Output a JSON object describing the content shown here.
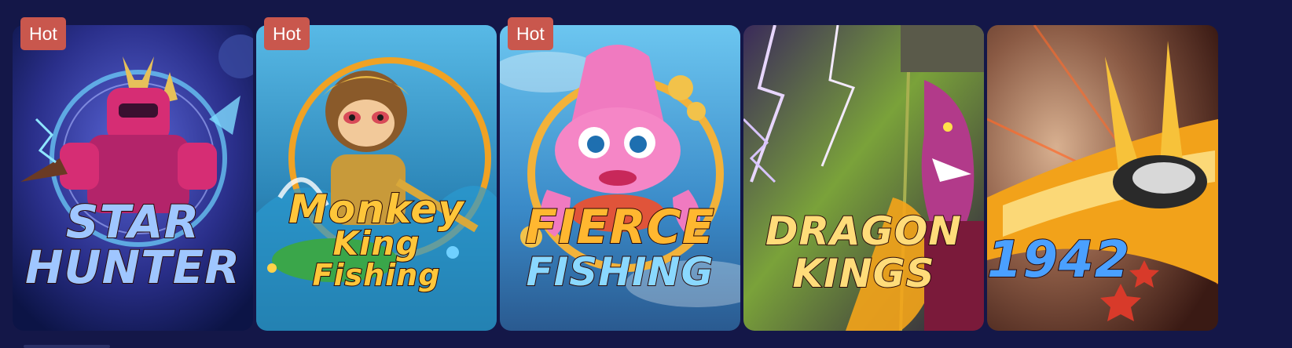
{
  "games": [
    {
      "badge": "Hot",
      "title_lines": [
        "STAR",
        "HUNTER"
      ],
      "colors": {
        "bg1": "#2a2f8a",
        "bg2": "#0c1446",
        "accent": "#d62d74",
        "title": "#9fc6ff"
      },
      "icon": "robot-hunter-icon"
    },
    {
      "badge": "Hot",
      "title_lines": [
        "Monkey",
        "King",
        "Fishing"
      ],
      "colors": {
        "bg1": "#3aa6d8",
        "bg2": "#1a4f7a",
        "accent": "#e8a21d",
        "title": "#ffc63a"
      },
      "icon": "monkey-king-icon"
    },
    {
      "badge": "Hot",
      "title_lines": [
        "FIERCE",
        "FISHING"
      ],
      "colors": {
        "bg1": "#4fb6e6",
        "bg2": "#2a72b0",
        "accent": "#f07ac0",
        "title": "#ffb730"
      },
      "icon": "pink-squid-icon"
    },
    {
      "badge": "",
      "title_lines": [
        "DRAGON",
        "KINGS"
      ],
      "colors": {
        "bg1": "#5f8a2a",
        "bg2": "#2a1a40",
        "accent": "#9a2a8c",
        "title": "#ffdc7a"
      },
      "icon": "dragon-king-icon"
    },
    {
      "badge": "",
      "title_lines": [
        "1942"
      ],
      "colors": {
        "bg1": "#7a5a50",
        "bg2": "#3a1a14",
        "accent": "#f2a21a",
        "title": "#4aa0ff"
      },
      "icon": "fighter-jet-icon"
    }
  ]
}
